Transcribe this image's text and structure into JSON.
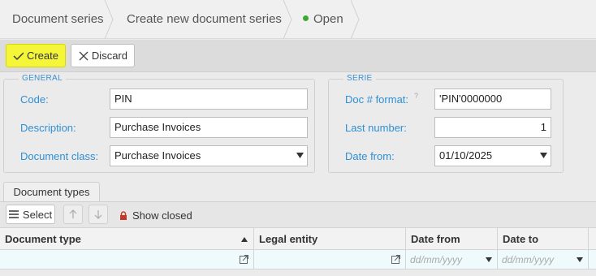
{
  "breadcrumb": {
    "items": [
      "Document series",
      "Create new document series"
    ],
    "status_label": "Open",
    "status_color": "#3aaa35"
  },
  "toolbar": {
    "create_label": "Create",
    "discard_label": "Discard"
  },
  "general": {
    "legend": "GENERAL",
    "code_label": "Code:",
    "code_value": "PIN",
    "description_label": "Description:",
    "description_value": "Purchase Invoices",
    "docclass_label": "Document class:",
    "docclass_value": "Purchase Invoices"
  },
  "serie": {
    "legend": "SERIE",
    "format_label": "Doc # format:",
    "format_help": "?",
    "format_value": "'PIN'0000000",
    "lastnum_label": "Last number:",
    "lastnum_value": "1",
    "datefrom_label": "Date from:",
    "datefrom_value": "01/10/2025"
  },
  "tabs": [
    {
      "label": "Document types"
    }
  ],
  "subtoolbar": {
    "select_label": "Select",
    "show_closed_label": "Show closed"
  },
  "grid": {
    "columns": [
      "Document type",
      "Legal entity",
      "Date from",
      "Date to"
    ],
    "date_placeholder": "dd/mm/yyyy"
  },
  "colors": {
    "accent": "#2f8fd3",
    "create_button": "#f5f53a",
    "lock": "#c0392b"
  }
}
